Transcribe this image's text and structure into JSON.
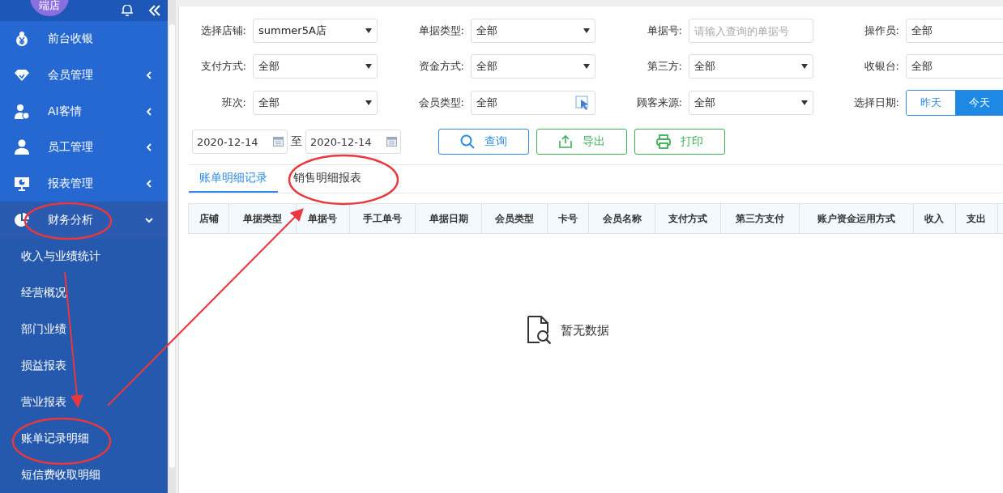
{
  "sidebar": {
    "avatar_text": "端店",
    "menu": [
      {
        "label": "前台收银",
        "kind": "link",
        "expanded": false
      },
      {
        "label": "会员管理",
        "kind": "group",
        "expanded": false
      },
      {
        "label": "AI客情",
        "kind": "group",
        "expanded": false
      },
      {
        "label": "员工管理",
        "kind": "group",
        "expanded": false
      },
      {
        "label": "报表管理",
        "kind": "group",
        "expanded": false
      },
      {
        "label": "财务分析",
        "kind": "group",
        "expanded": true,
        "children": [
          {
            "label": "收入与业绩统计",
            "selected": false
          },
          {
            "label": "经营概况",
            "selected": false
          },
          {
            "label": "部门业绩",
            "selected": false
          },
          {
            "label": "损益报表",
            "selected": false
          },
          {
            "label": "营业报表",
            "selected": false
          },
          {
            "label": "账单记录明细",
            "selected": false
          },
          {
            "label": "短信费收取明细",
            "selected": false
          }
        ]
      }
    ]
  },
  "filters": [
    {
      "label": "选择店铺:",
      "kind": "select",
      "value": "summer5A店"
    },
    {
      "label": "单据类型:",
      "kind": "select",
      "value": "全部"
    },
    {
      "label": "单据号:",
      "kind": "input",
      "placeholder": "请输入查询的单据号"
    },
    {
      "label": "操作员:",
      "kind": "plain",
      "value": "全部"
    },
    {
      "label": "支付方式:",
      "kind": "select",
      "value": "全部"
    },
    {
      "label": "资金方式:",
      "kind": "select",
      "value": "全部"
    },
    {
      "label": "第三方:",
      "kind": "select",
      "value": "全部"
    },
    {
      "label": "收银台:",
      "kind": "plain",
      "value": "全部"
    },
    {
      "label": "班次:",
      "kind": "select",
      "value": "全部"
    },
    {
      "label": "会员类型:",
      "kind": "picker",
      "value": "全部"
    },
    {
      "label": "顾客来源:",
      "kind": "select",
      "value": "全部"
    },
    {
      "label": "选择日期:",
      "kind": "toggle",
      "options": [
        {
          "label": "昨天",
          "selected": false
        },
        {
          "label": "今天",
          "selected": true
        }
      ]
    }
  ],
  "date_range": {
    "from": "2020-12-14",
    "separator": "至",
    "to": "2020-12-14"
  },
  "actions": [
    {
      "label": "查询",
      "kind": "search"
    },
    {
      "label": "导出",
      "kind": "export"
    },
    {
      "label": "打印",
      "kind": "print"
    }
  ],
  "tabs": [
    {
      "label": "账单明细记录",
      "selected": true
    },
    {
      "label": "销售明细报表",
      "selected": false
    }
  ],
  "table": {
    "columns": [
      "店铺",
      "单据类型",
      "单据号",
      "手工单号",
      "单据日期",
      "会员类型",
      "卡号",
      "会员名称",
      "支付方式",
      "第三方支付",
      "账户资金运用方式",
      "收入",
      "支出"
    ],
    "empty_text": "暂无数据"
  }
}
